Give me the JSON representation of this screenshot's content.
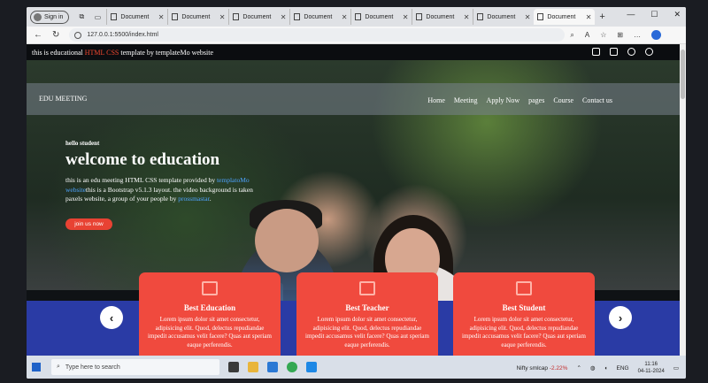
{
  "browser": {
    "signin_label": "Sign in",
    "tabs": [
      "Document",
      "Document",
      "Document",
      "Document",
      "Document",
      "Document",
      "Document",
      "Document"
    ],
    "active_tab_index": 7,
    "url": "127.0.0.1:5500/index.html"
  },
  "page": {
    "top_strip": {
      "prefix": "this is educational ",
      "highlight": "HTML CSS",
      "suffix": " template by templateMo website"
    },
    "brand": "EDU MEETING",
    "menu": [
      "Home",
      "Meeting",
      "Apply Now",
      "pages",
      "Course",
      "Contact us"
    ],
    "hero": {
      "kicker": "hello student",
      "title": "welcome to education",
      "desc_1": "this is an edu meeting HTML CSS template provided by ",
      "desc_link_1": "templatoMo website",
      "desc_2": "this is a Bootstrap v5.1.3 layout. the video background is taken paxels website, a group of your people by ",
      "desc_link_2": "prossmastar",
      "desc_3": ".",
      "button": "join us now"
    },
    "cards": [
      {
        "title": "Best Education",
        "text": "Lorem ipsum dolor sit amet consectetur, adipisicing elit. Quod, delectus repudiandae impedit accusamus velit facere? Quas aut speriam eaque perferendis."
      },
      {
        "title": "Best Teacher",
        "text": "Lorem ipsum dolor sit amet consectetur, adipisicing elit. Quod, delectus repudiandae impedit accusamus velit facere? Quas aut speriam eaque perferendis."
      },
      {
        "title": "Best Student",
        "text": "Lorem ipsum dolor sit amet consectetur, adipisicing elit. Quod, delectus repudiandae impedit accusamus velit facere? Quas aut speriam eaque perferendis."
      }
    ],
    "arrows": {
      "prev": "‹",
      "next": "›"
    }
  },
  "taskbar": {
    "search_placeholder": "Type here to search",
    "stock_name": "Nifty smlcap",
    "stock_change": "-2.22%",
    "lang": "ENG",
    "time": "11:16",
    "date": "04-11-2024"
  },
  "colors": {
    "accent_red": "#f04a3e",
    "band_blue": "#2a3ba5",
    "link_blue": "#4ea3ff"
  }
}
